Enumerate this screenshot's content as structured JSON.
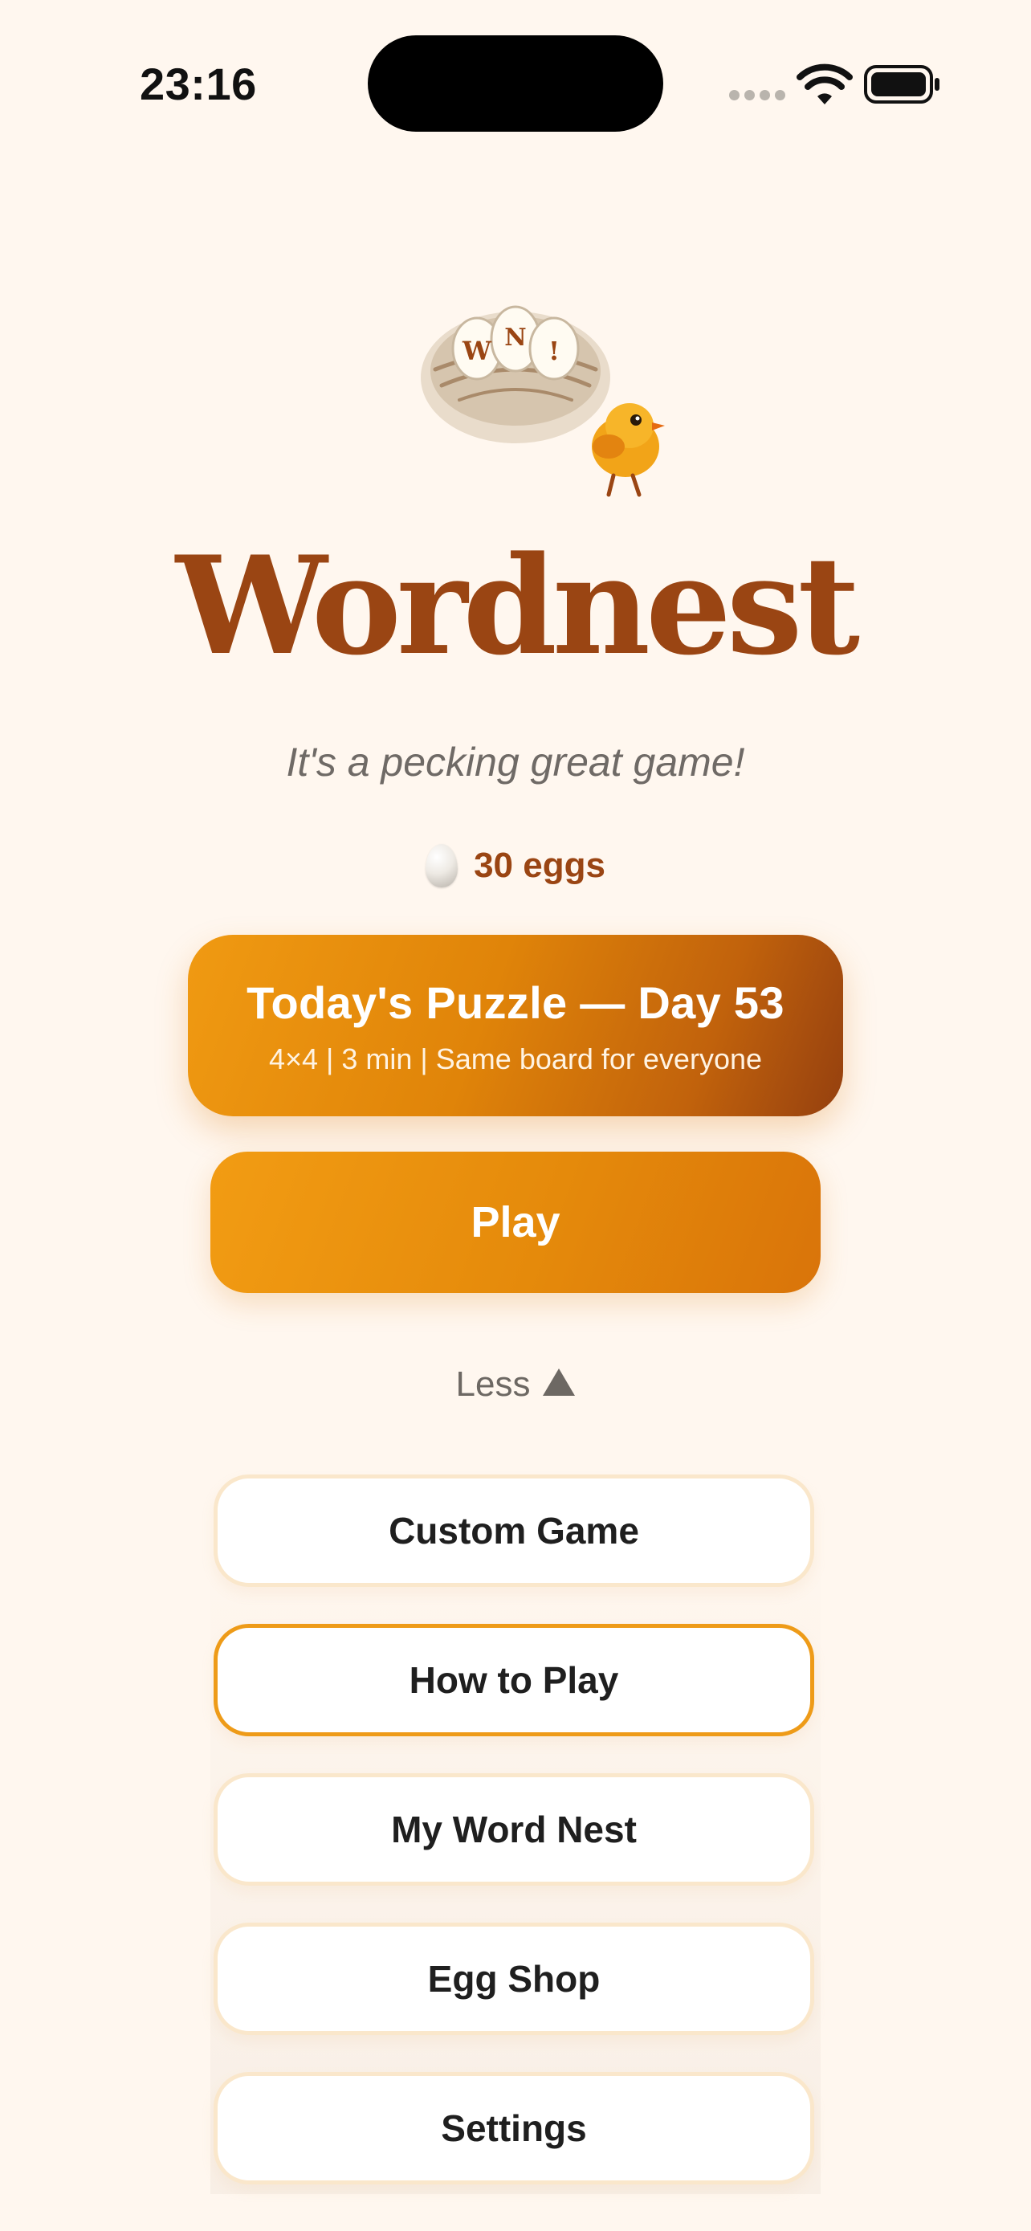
{
  "status_bar": {
    "time": "23:16"
  },
  "hero": {
    "mascot_egg_letters": [
      "W",
      "N",
      "!"
    ],
    "title": "Wordnest",
    "tagline": "It's a pecking great game!",
    "eggs_label": "30 eggs"
  },
  "daily": {
    "title": "Today's Puzzle — Day 53",
    "subtitle": "4×4 | 3 min | Same board for everyone"
  },
  "play": {
    "label": "Play"
  },
  "toggle": {
    "label": "Less"
  },
  "menu": {
    "items": [
      {
        "label": "Custom Game"
      },
      {
        "label": "How to Play"
      },
      {
        "label": "My Word Nest"
      },
      {
        "label": "Egg Shop"
      },
      {
        "label": "Settings"
      }
    ]
  },
  "colors": {
    "background": "#FFF7EF",
    "brand_brown": "#9A4513",
    "accent_orange": "#EE9B18",
    "menu_border": "#FAE7CB"
  },
  "icons": [
    "wifi-icon",
    "battery-icon",
    "egg-icon",
    "triangle-up-icon",
    "nest-chick-logo"
  ]
}
